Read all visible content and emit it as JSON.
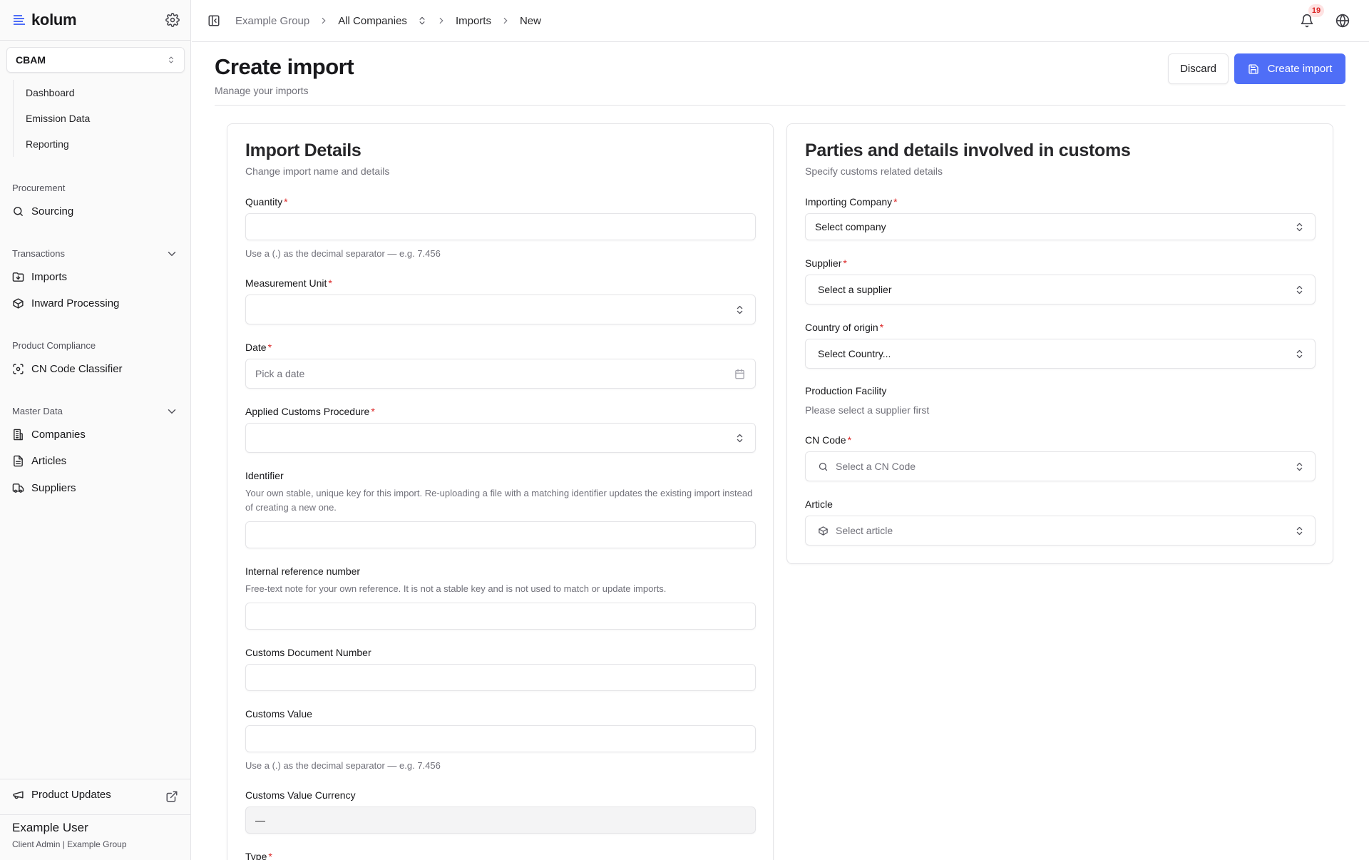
{
  "app": {
    "brand": "kolum",
    "module": "CBAM",
    "accent": "#4f6ef7"
  },
  "sidebar": {
    "sub_items": [
      "Dashboard",
      "Emission Data",
      "Reporting"
    ],
    "groups": {
      "procurement": {
        "label": "Procurement",
        "items": [
          {
            "label": "Sourcing",
            "icon": "search-icon"
          }
        ]
      },
      "transactions": {
        "label": "Transactions",
        "items": [
          {
            "label": "Imports",
            "icon": "folder-import-icon"
          },
          {
            "label": "Inward Processing",
            "icon": "box-icon"
          }
        ]
      },
      "compliance": {
        "label": "Product Compliance",
        "items": [
          {
            "label": "CN Code Classifier",
            "icon": "scan-icon"
          }
        ]
      },
      "master": {
        "label": "Master Data",
        "items": [
          {
            "label": "Companies",
            "icon": "building-icon"
          },
          {
            "label": "Articles",
            "icon": "file-icon"
          },
          {
            "label": "Suppliers",
            "icon": "truck-icon"
          }
        ]
      }
    },
    "product_updates": "Product Updates",
    "user": {
      "name": "Example User",
      "role": "Client Admin | Example Group"
    }
  },
  "topbar": {
    "breadcrumbs": [
      "Example Group",
      "All Companies",
      "Imports",
      "New"
    ],
    "notifications": "19"
  },
  "page": {
    "title": "Create import",
    "subtitle": "Manage your imports",
    "discard": "Discard",
    "create": "Create import"
  },
  "import_details": {
    "title": "Import Details",
    "description": "Change import name and details",
    "quantity": {
      "label": "Quantity",
      "help": "Use a (.) as the decimal separator — e.g. 7.456"
    },
    "measurement_unit": {
      "label": "Measurement Unit"
    },
    "date": {
      "label": "Date",
      "placeholder": "Pick a date"
    },
    "customs_procedure": {
      "label": "Applied Customs Procedure"
    },
    "identifier": {
      "label": "Identifier",
      "help": "Your own stable, unique key for this import. Re-uploading a file with a matching identifier updates the existing import instead of creating a new one."
    },
    "internal_ref": {
      "label": "Internal reference number",
      "help": "Free-text note for your own reference. It is not a stable key and is not used to match or update imports."
    },
    "customs_doc": {
      "label": "Customs Document Number"
    },
    "customs_value": {
      "label": "Customs Value",
      "help": "Use a (.) as the decimal separator — e.g. 7.456"
    },
    "customs_currency": {
      "label": "Customs Value Currency",
      "value": "—"
    },
    "type": {
      "label": "Type"
    }
  },
  "customs": {
    "title": "Parties and details involved in customs",
    "description": "Specify customs related details",
    "importing_company": {
      "label": "Importing Company",
      "value": "Select company"
    },
    "supplier": {
      "label": "Supplier",
      "value": "Select a supplier"
    },
    "country": {
      "label": "Country of origin",
      "value": "Select Country..."
    },
    "facility": {
      "label": "Production Facility",
      "help": "Please select a supplier first"
    },
    "cn_code": {
      "label": "CN Code",
      "placeholder": "Select a CN Code"
    },
    "article": {
      "label": "Article",
      "placeholder": "Select article"
    }
  }
}
